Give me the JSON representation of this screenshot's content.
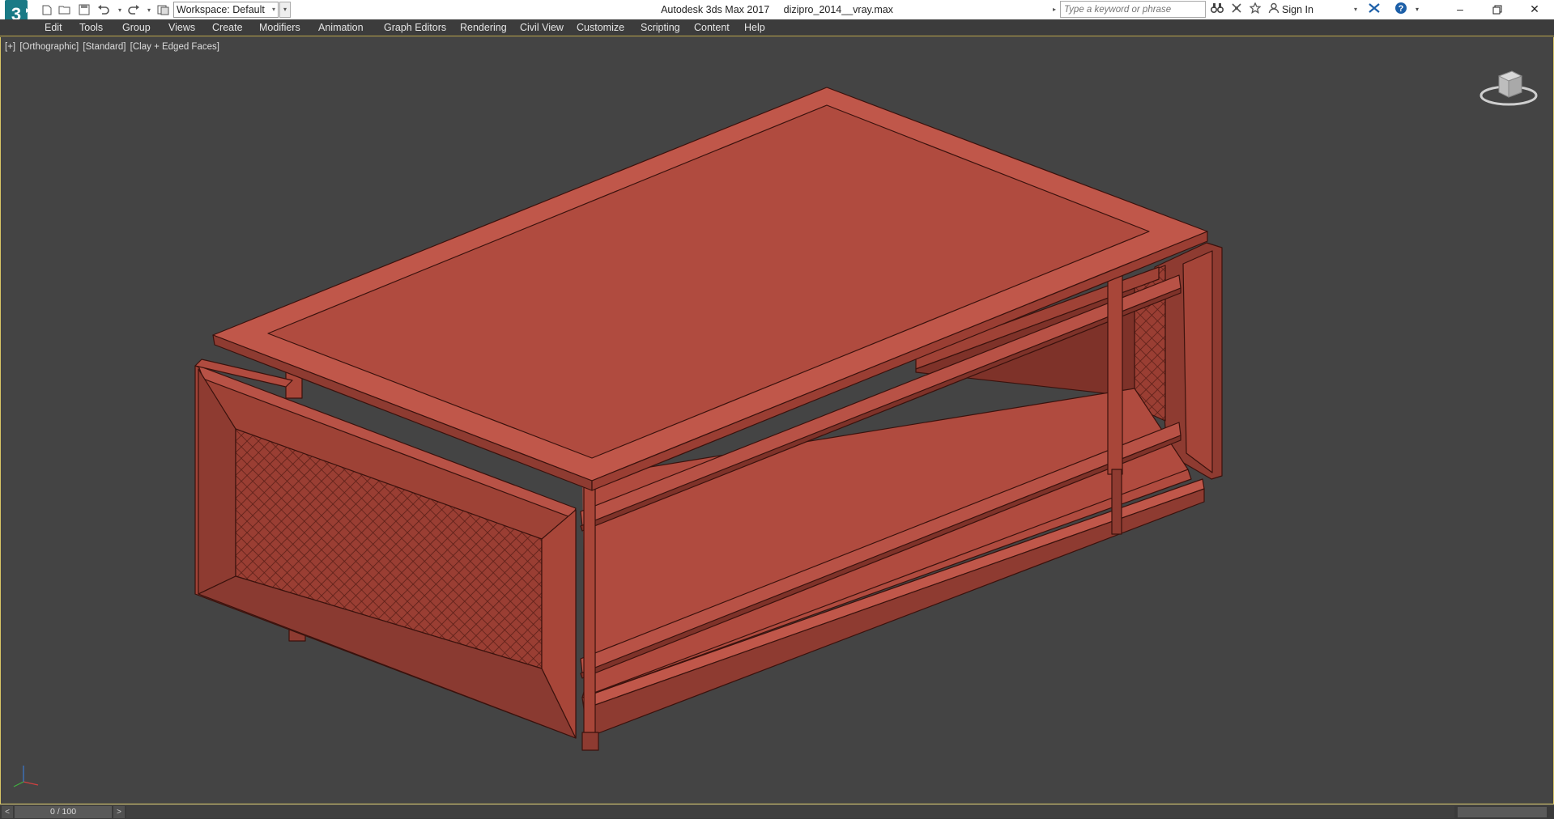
{
  "window": {
    "app_name": "Autodesk 3ds Max 2017",
    "file_name": "dizipro_2014__vray.max"
  },
  "quick_access": {
    "workspace_value": "Workspace: Default"
  },
  "search": {
    "placeholder": "Type a keyword or phrase"
  },
  "account": {
    "sign_in_label": "Sign In"
  },
  "menu": {
    "items": [
      "Edit",
      "Tools",
      "Group",
      "Views",
      "Create",
      "Modifiers",
      "Animation",
      "Graph Editors",
      "Rendering",
      "Civil View",
      "Customize",
      "Scripting",
      "Content",
      "Help"
    ]
  },
  "viewport": {
    "label_plus": "[+]",
    "label_view": "[Orthographic]",
    "label_shading": "[Standard]",
    "label_style": "[Clay + Edged Faces]"
  },
  "timeline": {
    "frame_display": "0 / 100",
    "prev_label": "<",
    "next_label": ">"
  },
  "colors": {
    "clay": "#b04b3f",
    "clay_dark": "#8a3a31",
    "clay_light": "#c0574a",
    "viewport_bg": "#444444",
    "viewport_border": "#d8c565"
  },
  "icons": [
    "3dsmax-logo-icon",
    "new-file-icon",
    "open-file-icon",
    "save-icon",
    "undo-icon",
    "redo-icon",
    "project-icon",
    "binoculars-icon",
    "communication-icon",
    "favorites-icon",
    "user-icon",
    "exchange-icon",
    "help-icon",
    "minimize-icon",
    "restore-icon",
    "close-icon",
    "viewcube-icon",
    "axis-tripod-icon"
  ]
}
